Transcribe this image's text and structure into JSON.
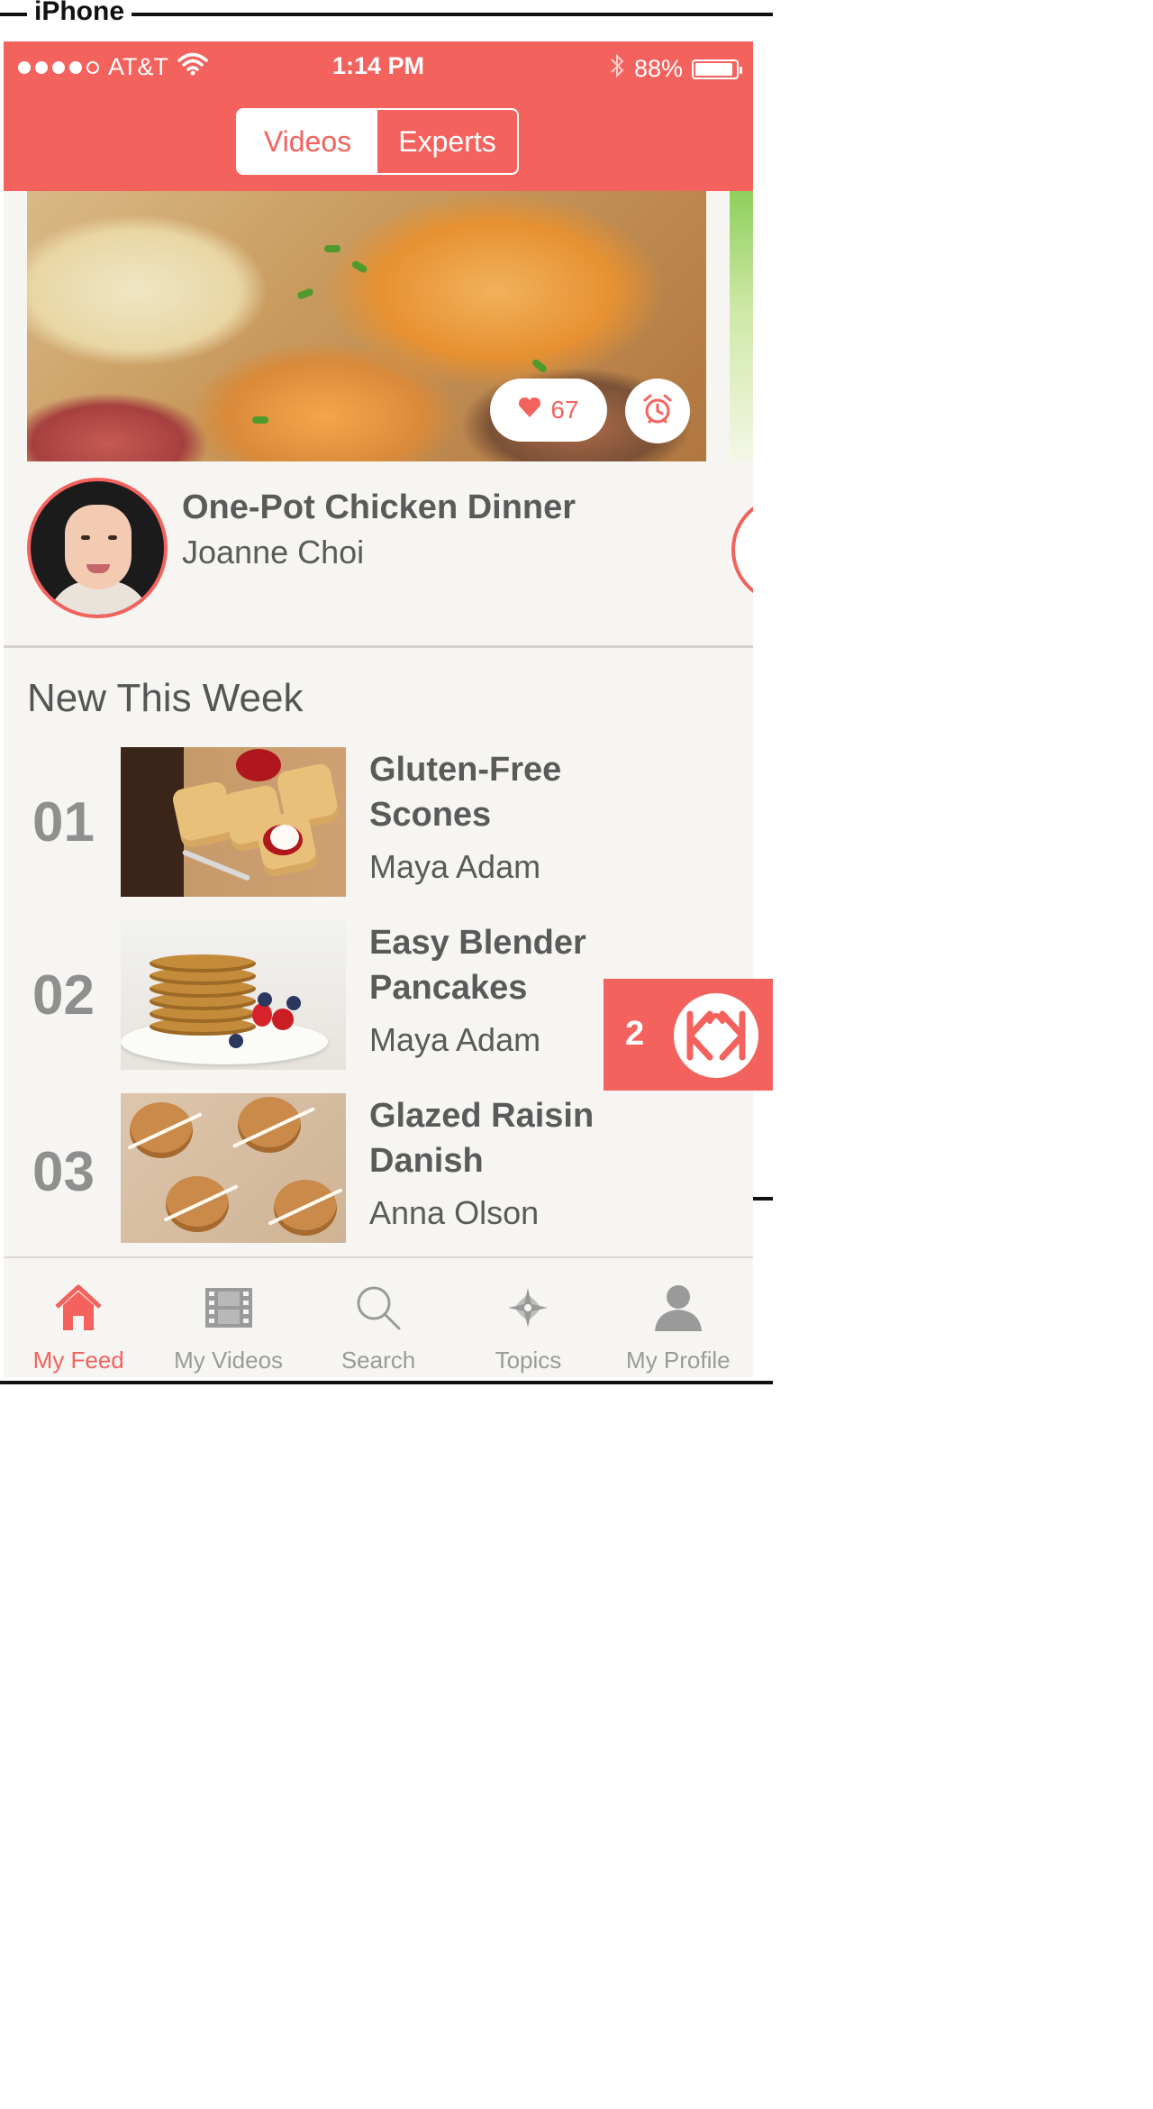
{
  "device": {
    "label": "iPhone"
  },
  "status_bar": {
    "carrier": "AT&T",
    "time": "1:14 PM",
    "battery": "88%"
  },
  "segment": {
    "videos_label": "Videos",
    "experts_label": "Experts",
    "selected": "Videos"
  },
  "featured": {
    "title": "One-Pot Chicken Dinner",
    "author": "Joanne Choi",
    "likes": "67"
  },
  "new_this_week": {
    "heading": "New This Week",
    "items": [
      {
        "number": "01",
        "title_line1": "Gluten-Free",
        "title_line2": "Scones",
        "author": "Maya Adam"
      },
      {
        "number": "02",
        "title_line1": "Easy Blender",
        "title_line2": "Pancakes",
        "author": "Maya Adam"
      },
      {
        "number": "03",
        "title_line1": "Glazed Raisin",
        "title_line2": "Danish",
        "author": "Anna Olson"
      }
    ]
  },
  "notification_badge": {
    "count": "2"
  },
  "tabbar": {
    "items": [
      {
        "label": "My Feed",
        "icon": "home-icon"
      },
      {
        "label": "My Videos",
        "icon": "film-icon"
      },
      {
        "label": "Search",
        "icon": "search-icon"
      },
      {
        "label": "Topics",
        "icon": "compass-star-icon"
      },
      {
        "label": "My Profile",
        "icon": "person-icon"
      }
    ],
    "active": "My Feed"
  },
  "colors": {
    "accent": "#f4625d",
    "background": "#f7f5f2",
    "text": "#5a5a5a",
    "muted": "#9a9a9a"
  }
}
